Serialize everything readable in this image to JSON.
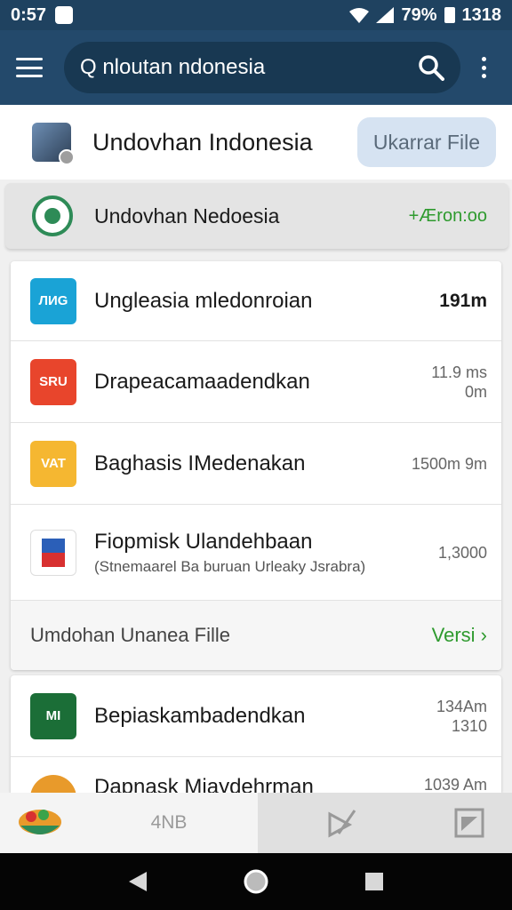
{
  "status_bar": {
    "time": "0:57",
    "battery": "79%",
    "clock": "1318"
  },
  "search": {
    "query": "Q nloutan ndonesia"
  },
  "header": {
    "title": "Undovhan Indonesia",
    "button_label": "Ukarrar File"
  },
  "featured": {
    "title": "Undovhan Nedoesia",
    "value": "+Æron:oo"
  },
  "list": [
    {
      "title": "Ungleasia mledonroian",
      "meta": "191m",
      "icon_text": "ЛИG",
      "color": "#1aa3d6"
    },
    {
      "title": "Drapeacamaadendkan",
      "meta": "11.9 ms 0m",
      "icon_text": "SRU",
      "color": "#e8452c"
    },
    {
      "title": "Baghasis IMedenakan",
      "meta": "1500m 9m",
      "icon_text": "VAT",
      "color": "#f5b731"
    },
    {
      "title": "Fiopmisk Ulandehbaan",
      "subtitle": "(Stnemaarel Ba buruan Urleaky Jsrabra)",
      "meta": "1,3000",
      "icon_text": "",
      "color": "#2b5fb8"
    }
  ],
  "section_footer": {
    "label": "Umdohan Unanea Fille",
    "link": "Versi ›"
  },
  "list2": [
    {
      "title": "Bepiaskambadendkan",
      "meta": "134Am 1310",
      "icon_text": "MI",
      "color": "#1b6e37"
    },
    {
      "title": "Dapnask Miaydehrman",
      "meta": "1039 Am",
      "icon_text": "",
      "color": "#e89a2b"
    }
  ],
  "bottom_tabs": {
    "label": "4NB"
  },
  "colors": {
    "app_bar": "#23496b",
    "status_bar": "#1f4260",
    "accent_green": "#2e9a2e"
  }
}
